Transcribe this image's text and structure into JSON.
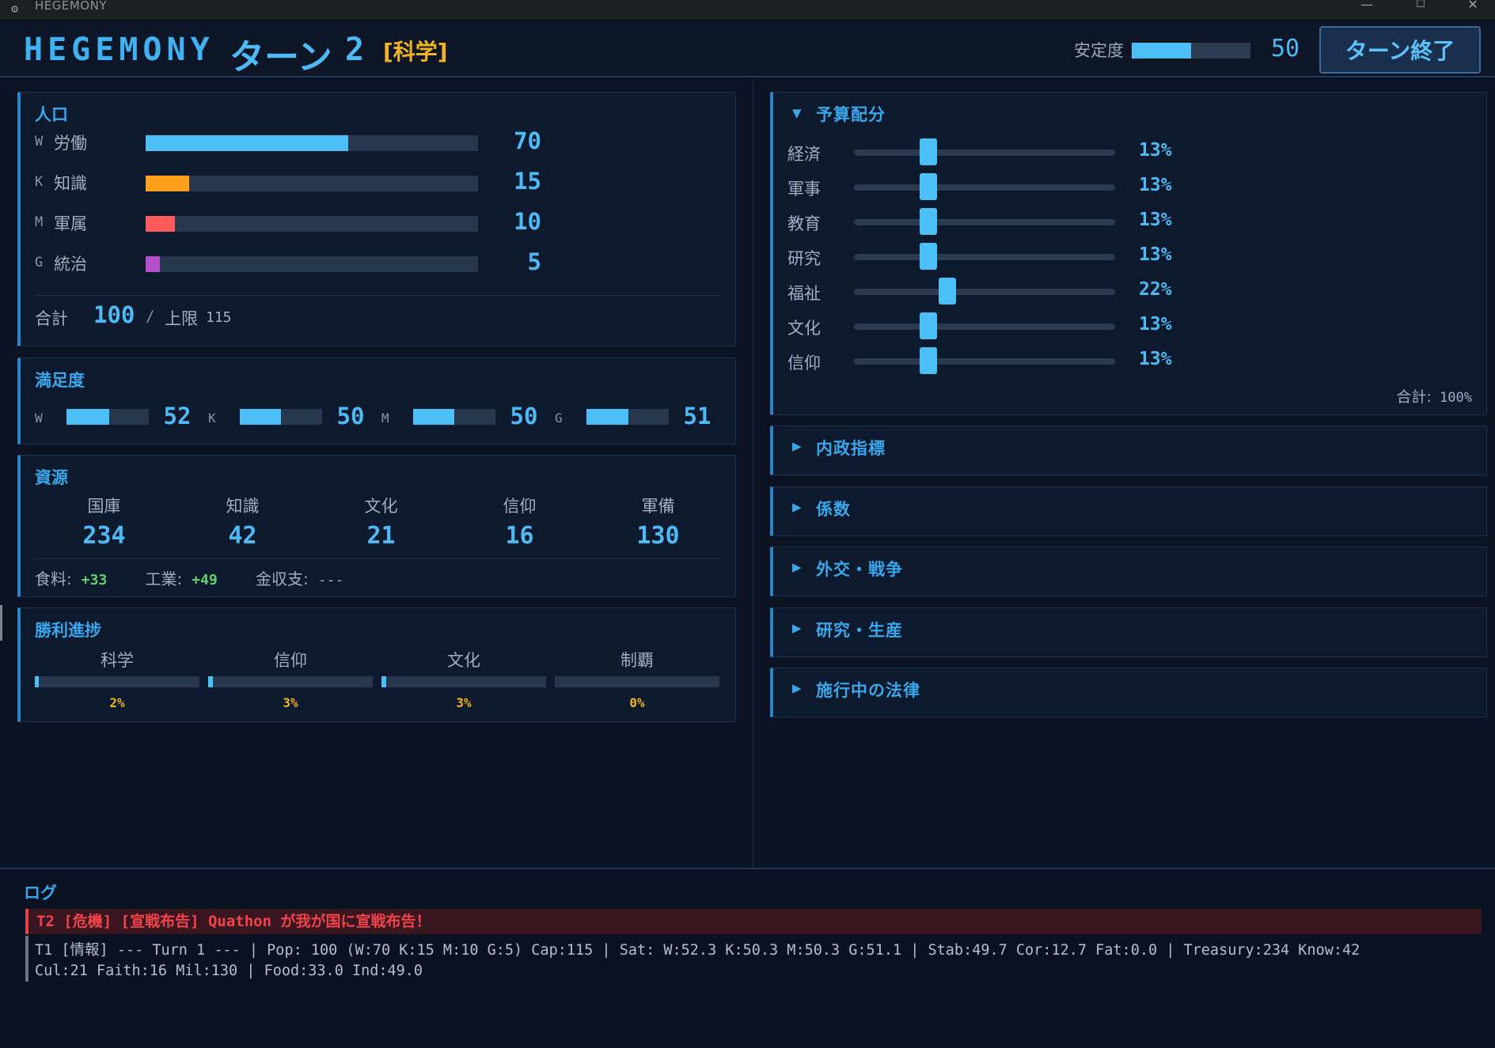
{
  "window": {
    "title": "HEGEMONY",
    "minimize": "—",
    "maximize": "☐",
    "close": "✕"
  },
  "header": {
    "brand": "HEGEMONY",
    "turn_label": "ターン",
    "turn_number": "2",
    "mode": "[科学]",
    "stability_label": "安定度",
    "stability_value": "50",
    "stability_fraction": 0.5,
    "end_turn": "ターン終了"
  },
  "population": {
    "title": "人口",
    "rows": [
      {
        "code": "W",
        "name": "労働",
        "value": "70",
        "fraction": 0.61,
        "color": "#4cbff6"
      },
      {
        "code": "K",
        "name": "知識",
        "value": "15",
        "fraction": 0.13,
        "color": "#ff9f1a"
      },
      {
        "code": "M",
        "name": "軍属",
        "value": "10",
        "fraction": 0.087,
        "color": "#ff5b5b"
      },
      {
        "code": "G",
        "name": "統治",
        "value": "5",
        "fraction": 0.043,
        "color": "#b24fc9"
      }
    ],
    "total_label": "合計",
    "total_value": "100",
    "slash": "/",
    "cap_label": "上限",
    "cap_value": "115"
  },
  "satisfaction": {
    "title": "満足度",
    "groups": [
      {
        "code": "W",
        "value": "52",
        "fraction": 0.52
      },
      {
        "code": "K",
        "value": "50",
        "fraction": 0.5
      },
      {
        "code": "M",
        "value": "50",
        "fraction": 0.5
      },
      {
        "code": "G",
        "value": "51",
        "fraction": 0.51
      }
    ]
  },
  "resources": {
    "title": "資源",
    "items": [
      {
        "name": "国庫",
        "value": "234"
      },
      {
        "name": "知識",
        "value": "42"
      },
      {
        "name": "文化",
        "value": "21"
      },
      {
        "name": "信仰",
        "value": "16"
      },
      {
        "name": "軍備",
        "value": "130"
      }
    ],
    "food_label": "食料:",
    "food_value": "+33",
    "industry_label": "工業:",
    "industry_value": "+49",
    "gold_label": "金収支:",
    "gold_value": "---"
  },
  "victory": {
    "title": "勝利進捗",
    "items": [
      {
        "name": "科学",
        "value": "2%",
        "fraction": 0.02
      },
      {
        "name": "信仰",
        "value": "3%",
        "fraction": 0.03
      },
      {
        "name": "文化",
        "value": "3%",
        "fraction": 0.03
      },
      {
        "name": "制覇",
        "value": "0%",
        "fraction": 0.0
      }
    ]
  },
  "budget": {
    "title": "予算配分",
    "expanded_icon": "▼",
    "items": [
      {
        "name": "経済",
        "value": "13%",
        "fraction": 0.13
      },
      {
        "name": "軍事",
        "value": "13%",
        "fraction": 0.13
      },
      {
        "name": "教育",
        "value": "13%",
        "fraction": 0.13
      },
      {
        "name": "研究",
        "value": "13%",
        "fraction": 0.13
      },
      {
        "name": "福祉",
        "value": "22%",
        "fraction": 0.22
      },
      {
        "name": "文化",
        "value": "13%",
        "fraction": 0.13
      },
      {
        "name": "信仰",
        "value": "13%",
        "fraction": 0.13
      }
    ],
    "total_label": "合計:",
    "total_value": "100%"
  },
  "sections": {
    "collapsed_icon": "▶",
    "items": [
      {
        "title": "内政指標"
      },
      {
        "title": "係数"
      },
      {
        "title": "外交・戦争"
      },
      {
        "title": "研究・生産"
      },
      {
        "title": "施行中の法律"
      }
    ]
  },
  "log": {
    "title": "ログ",
    "alert": "T2 [危機] [宣戦布告] Quathon が我が国に宣戦布告！",
    "line1": "T1 [情報] --- Turn 1 --- | Pop: 100 (W:70 K:15 M:10 G:5) Cap:115 | Sat: W:52.3 K:50.3 M:50.3 G:51.1 | Stab:49.7 Cor:12.7 Fat:0.0 | Treasury:234 Know:42",
    "line2": "Cul:21 Faith:16 Mil:130 | Food:33.0 Ind:49.0"
  }
}
